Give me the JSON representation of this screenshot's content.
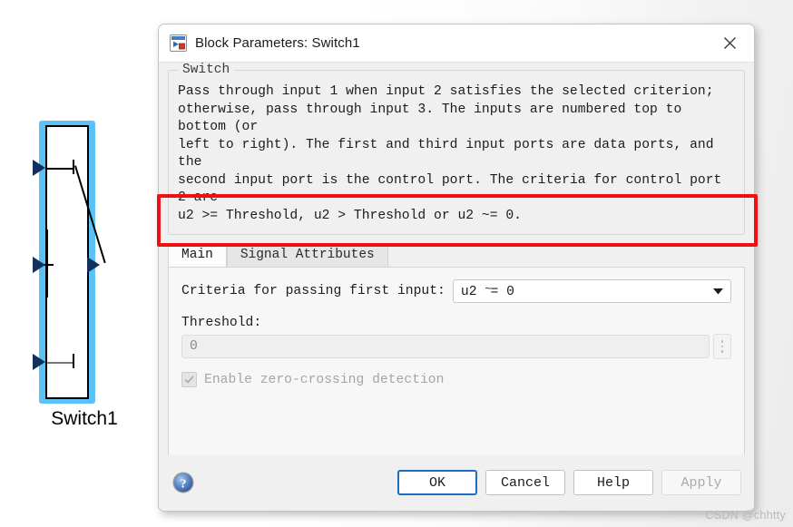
{
  "canvas": {
    "block": {
      "name": "switch-block",
      "label": "Switch1",
      "selected": true,
      "selection_color": "#5bc2f5",
      "port_color": "#14305c"
    }
  },
  "dialog": {
    "title": "Block Parameters: Switch1",
    "icon": "simulink-block-icon",
    "close_icon": "close-icon",
    "group": {
      "title": "Switch",
      "description": "Pass through input 1 when input 2 satisfies the selected criterion;\notherwise, pass through input 3. The inputs are numbered top to bottom (or\nleft to right). The first and third input ports are data ports, and the\nsecond input port is the control port. The criteria for control port 2 are\nu2 >= Threshold, u2 > Threshold or u2 ~= 0."
    },
    "tabs": [
      {
        "label": "Main",
        "active": true
      },
      {
        "label": "Signal Attributes",
        "active": false
      }
    ],
    "fields": {
      "criteria": {
        "label": "Criteria for passing first input:",
        "value_prefix": "u2 ",
        "value_tilde": "~",
        "value_suffix": "= 0",
        "value": "u2 ~= 0",
        "options": [
          "u2 >= Threshold",
          "u2 > Threshold",
          "u2 ~= 0"
        ],
        "dropdown_icon": "chevron-down-icon"
      },
      "threshold": {
        "label": "Threshold:",
        "value": "0",
        "disabled": true,
        "spinner_icon": "stepper-icon"
      },
      "zero_crossing": {
        "label": "Enable zero-crossing detection",
        "checked": true,
        "disabled": true,
        "check_icon": "checkmark-icon"
      }
    },
    "footer": {
      "help_icon": "help-icon",
      "buttons": [
        {
          "label": "OK",
          "style": "default",
          "disabled": false
        },
        {
          "label": "Cancel",
          "style": "normal",
          "disabled": false
        },
        {
          "label": "Help",
          "style": "normal",
          "disabled": false
        },
        {
          "label": "Apply",
          "style": "normal",
          "disabled": true
        }
      ]
    }
  },
  "annotation": {
    "name": "red-highlight-box",
    "color": "#ef1111"
  },
  "watermark": {
    "text": "CSDN @chhtty"
  }
}
